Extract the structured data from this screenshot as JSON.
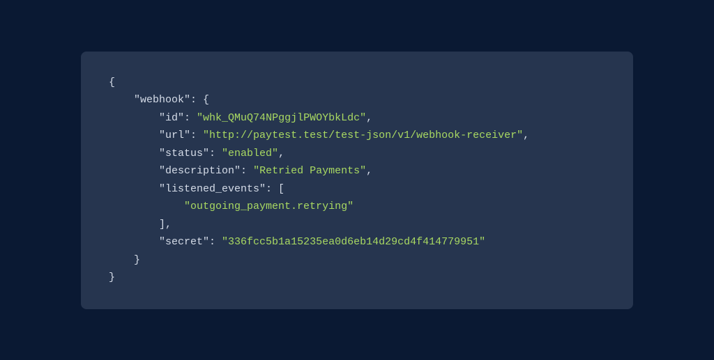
{
  "code": {
    "indent": "    ",
    "lines": [
      {
        "depth": 0,
        "tokens": [
          {
            "cls": "punct",
            "text": "{"
          }
        ]
      },
      {
        "depth": 1,
        "tokens": [
          {
            "cls": "key",
            "text": "\"webhook\""
          },
          {
            "cls": "punct",
            "text": ": {"
          }
        ]
      },
      {
        "depth": 2,
        "tokens": [
          {
            "cls": "key",
            "text": "\"id\""
          },
          {
            "cls": "punct",
            "text": ": "
          },
          {
            "cls": "string",
            "text": "\"whk_QMuQ74NPggjlPWOYbkLdc\""
          },
          {
            "cls": "punct",
            "text": ","
          }
        ]
      },
      {
        "depth": 2,
        "tokens": [
          {
            "cls": "key",
            "text": "\"url\""
          },
          {
            "cls": "punct",
            "text": ": "
          },
          {
            "cls": "string",
            "text": "\"http://paytest.test/test-json/v1/webhook-receiver\""
          },
          {
            "cls": "punct",
            "text": ","
          }
        ]
      },
      {
        "depth": 2,
        "tokens": [
          {
            "cls": "key",
            "text": "\"status\""
          },
          {
            "cls": "punct",
            "text": ": "
          },
          {
            "cls": "string",
            "text": "\"enabled\""
          },
          {
            "cls": "punct",
            "text": ","
          }
        ]
      },
      {
        "depth": 2,
        "tokens": [
          {
            "cls": "key",
            "text": "\"description\""
          },
          {
            "cls": "punct",
            "text": ": "
          },
          {
            "cls": "string",
            "text": "\"Retried Payments\""
          },
          {
            "cls": "punct",
            "text": ","
          }
        ]
      },
      {
        "depth": 2,
        "tokens": [
          {
            "cls": "key",
            "text": "\"listened_events\""
          },
          {
            "cls": "punct",
            "text": ": ["
          }
        ]
      },
      {
        "depth": 3,
        "tokens": [
          {
            "cls": "string",
            "text": "\"outgoing_payment.retrying\""
          }
        ]
      },
      {
        "depth": 2,
        "tokens": [
          {
            "cls": "punct",
            "text": "],"
          }
        ]
      },
      {
        "depth": 2,
        "tokens": [
          {
            "cls": "key",
            "text": "\"secret\""
          },
          {
            "cls": "punct",
            "text": ": "
          },
          {
            "cls": "string",
            "text": "\"336fcc5b1a15235ea0d6eb14d29cd4f414779951\""
          }
        ]
      },
      {
        "depth": 1,
        "tokens": [
          {
            "cls": "punct",
            "text": "}"
          }
        ]
      },
      {
        "depth": 0,
        "tokens": [
          {
            "cls": "punct",
            "text": "}"
          }
        ]
      }
    ]
  }
}
